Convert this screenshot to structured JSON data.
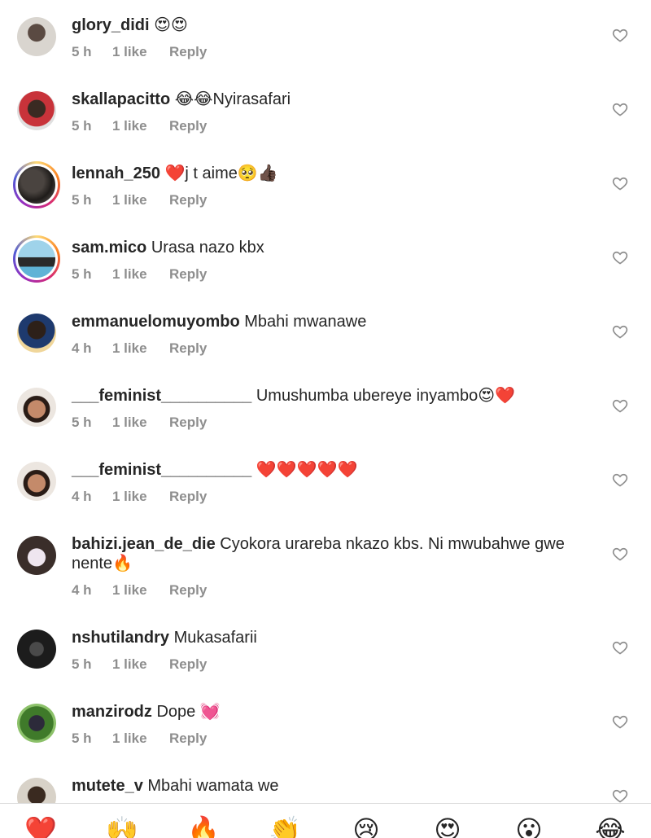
{
  "comments": [
    {
      "username": "glory_didi",
      "text": "😍😍",
      "time": "5 h",
      "likes": "1 like",
      "reply": "Reply"
    },
    {
      "username": "skallapacitto",
      "text": "😂😂Nyirasafari",
      "time": "5 h",
      "likes": "1 like",
      "reply": "Reply"
    },
    {
      "username": "lennah_250",
      "text": "❤️j t aime🥺👍🏿",
      "time": "5 h",
      "likes": "1 like",
      "reply": "Reply"
    },
    {
      "username": "sam.mico",
      "text": "Urasa nazo kbx",
      "time": "5 h",
      "likes": "1 like",
      "reply": "Reply"
    },
    {
      "username": "emmanuelomuyombo",
      "text": "Mbahi mwanawe",
      "time": "4 h",
      "likes": "1 like",
      "reply": "Reply"
    },
    {
      "username": "___feminist__________",
      "text": "Umushumba ubereye inyambo😍❤️",
      "time": "5 h",
      "likes": "1 like",
      "reply": "Reply"
    },
    {
      "username": "___feminist__________",
      "text": "❤️❤️❤️❤️❤️",
      "time": "4 h",
      "likes": "1 like",
      "reply": "Reply"
    },
    {
      "username": "bahizi.jean_de_die",
      "text": "Cyokora urareba nkazo kbs. Ni mwubahwe gwe nente🔥",
      "time": "4 h",
      "likes": "1 like",
      "reply": "Reply"
    },
    {
      "username": "nshutilandry",
      "text": "Mukasafarii",
      "time": "5 h",
      "likes": "1 like",
      "reply": "Reply"
    },
    {
      "username": "manzirodz",
      "text": "Dope 💓",
      "time": "5 h",
      "likes": "1 like",
      "reply": "Reply"
    },
    {
      "username": "mutete_v",
      "text": "Mbahi wamata we",
      "time": "",
      "likes": "",
      "reply": ""
    }
  ],
  "reactions": [
    "❤️",
    "🙌",
    "🔥",
    "👏",
    "😢",
    "😍",
    "😮",
    "😂"
  ],
  "icons": {
    "like": "heart-outline-icon"
  },
  "colors": {
    "text": "#262626",
    "meta": "#8e8e8e",
    "divider": "#dbdbdb"
  }
}
